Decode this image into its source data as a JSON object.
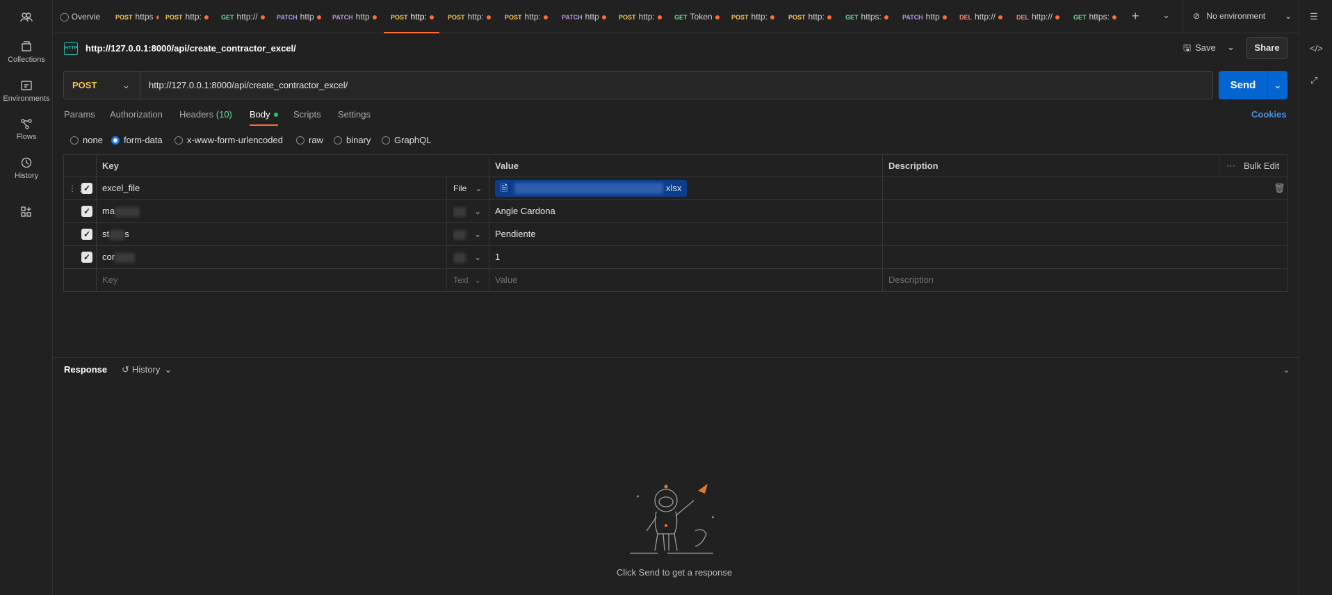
{
  "sidebar": {
    "items": [
      {
        "label": "Collections",
        "icon": "collections-icon"
      },
      {
        "label": "Environments",
        "icon": "environments-icon"
      },
      {
        "label": "Flows",
        "icon": "flows-icon"
      },
      {
        "label": "History",
        "icon": "history-icon"
      }
    ]
  },
  "tabs": [
    {
      "method": "",
      "label": "Overvie",
      "dot": false
    },
    {
      "method": "POST",
      "label": "https",
      "dot": true
    },
    {
      "method": "POST",
      "label": "http:",
      "dot": true
    },
    {
      "method": "GET",
      "label": "http://",
      "dot": true
    },
    {
      "method": "PATCH",
      "label": "http",
      "dot": true
    },
    {
      "method": "PATCH",
      "label": "http",
      "dot": true
    },
    {
      "method": "POST",
      "label": "http:",
      "dot": true
    },
    {
      "method": "POST",
      "label": "http:",
      "dot": true
    },
    {
      "method": "POST",
      "label": "http:",
      "dot": true
    },
    {
      "method": "PATCH",
      "label": "http",
      "dot": true
    },
    {
      "method": "POST",
      "label": "http:",
      "dot": true
    },
    {
      "method": "GET",
      "label": "Token",
      "dot": true
    },
    {
      "method": "POST",
      "label": "http:",
      "dot": true
    },
    {
      "method": "POST",
      "label": "http:",
      "dot": true
    },
    {
      "method": "GET",
      "label": "https:",
      "dot": true
    },
    {
      "method": "PATCH",
      "label": "http",
      "dot": true
    },
    {
      "method": "DEL",
      "label": "http://",
      "dot": true
    },
    {
      "method": "DEL",
      "label": "http://",
      "dot": true
    },
    {
      "method": "GET",
      "label": "https:",
      "dot": true
    }
  ],
  "environment": "No environment",
  "header": {
    "title": "http://127.0.0.1:8000/api/create_contractor_excel/",
    "save_label": "Save",
    "share_label": "Share"
  },
  "request": {
    "method": "POST",
    "url": "http://127.0.0.1:8000/api/create_contractor_excel/",
    "send_label": "Send"
  },
  "subtabs": {
    "params": "Params",
    "authorization": "Authorization",
    "headers": "Headers",
    "headers_count": "(10)",
    "body": "Body",
    "scripts": "Scripts",
    "settings": "Settings",
    "cookies": "Cookies"
  },
  "body_modes": [
    "none",
    "form-data",
    "x-www-form-urlencoded",
    "raw",
    "binary",
    "GraphQL"
  ],
  "table": {
    "headers": {
      "key": "Key",
      "value": "Value",
      "description": "Description",
      "bulk_edit": "Bulk Edit"
    },
    "rows": [
      {
        "key": "excel_file",
        "type": "File",
        "value": "xlsx"
      },
      {
        "key": "ma",
        "type": "",
        "value": "Angle Cardona"
      },
      {
        "key": "st",
        "key_tail": "s",
        "type": "",
        "value": "Pendiente"
      },
      {
        "key": "cor",
        "type": "",
        "value": "1"
      }
    ],
    "placeholder": {
      "key": "Key",
      "type": "Text",
      "value": "Value",
      "description": "Description"
    }
  },
  "response": {
    "label": "Response",
    "history_label": "History",
    "empty_message": "Click Send to get a response"
  }
}
